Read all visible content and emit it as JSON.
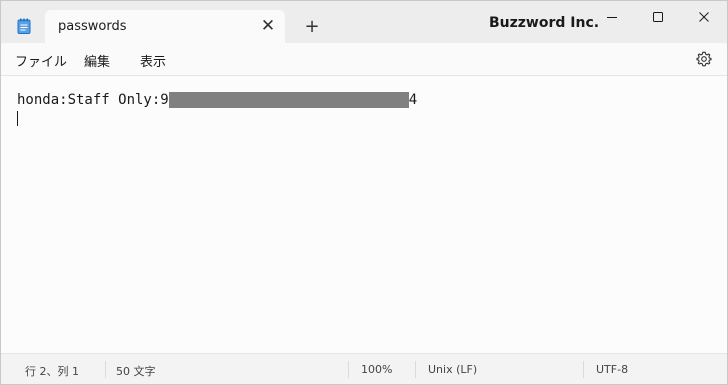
{
  "titlebar": {
    "tab_title": "passwords",
    "tab_close": "✕",
    "new_tab": "+",
    "app_name": "Buzzword Inc."
  },
  "menu": {
    "file": "ファイル",
    "edit": "編集",
    "view": "表示"
  },
  "editor": {
    "line1_prefix": "honda:Staff Only:9",
    "line1_suffix": "4"
  },
  "status": {
    "position": "行 2、列 1",
    "char_count": "50 文字",
    "zoom": "100%",
    "line_ending": "Unix (LF)",
    "encoding": "UTF-8"
  },
  "colors": {
    "accent_icon": "#1e7ad6",
    "redaction": "#808080"
  }
}
